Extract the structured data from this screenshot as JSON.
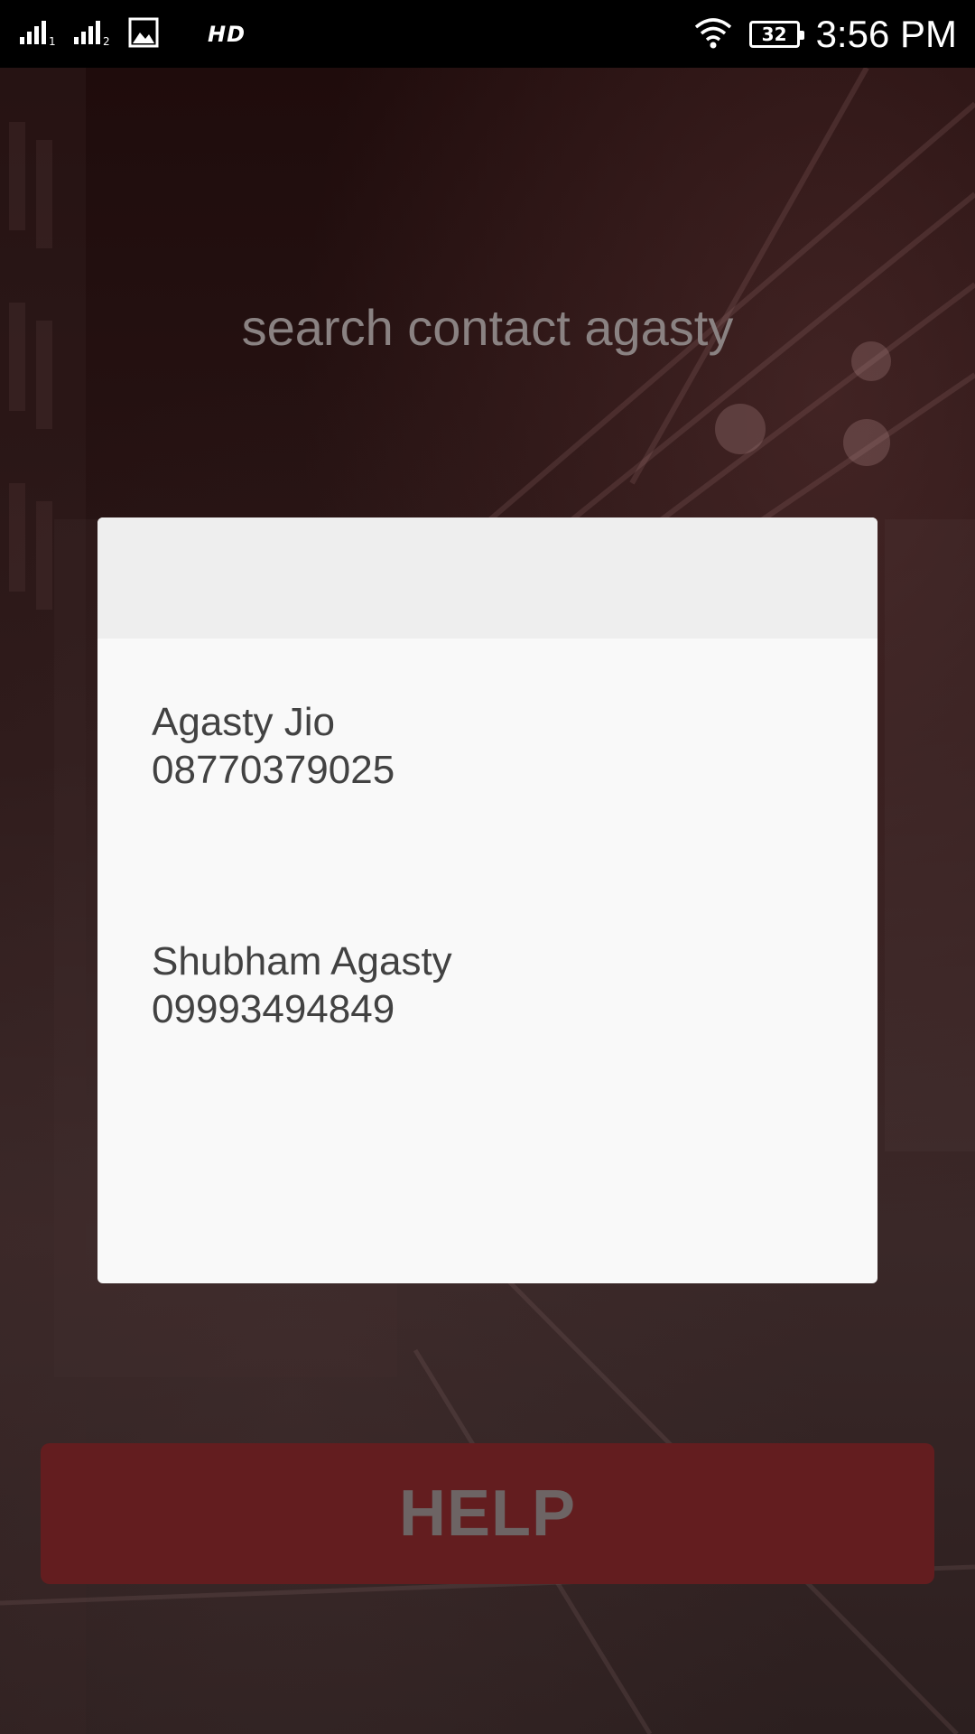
{
  "status_bar": {
    "hd_label": "HD",
    "battery_level": "32",
    "time": "3:56 PM",
    "icons": [
      "signal-sim1-icon",
      "signal-sim2-icon",
      "gallery-notification-icon",
      "wifi-icon",
      "battery-icon"
    ]
  },
  "search": {
    "title": "search contact agasty"
  },
  "results": {
    "contacts": [
      {
        "name": "Agasty Jio",
        "phone": "08770379025"
      },
      {
        "name": "Shubham Agasty",
        "phone": "09993494849"
      }
    ]
  },
  "help_button": {
    "label": "HELP"
  },
  "colors": {
    "help_button_bg": "#631d1f",
    "card_bg": "#f9f9f9",
    "card_header_bg": "#eeeeee",
    "title_text": "#8a8282"
  }
}
